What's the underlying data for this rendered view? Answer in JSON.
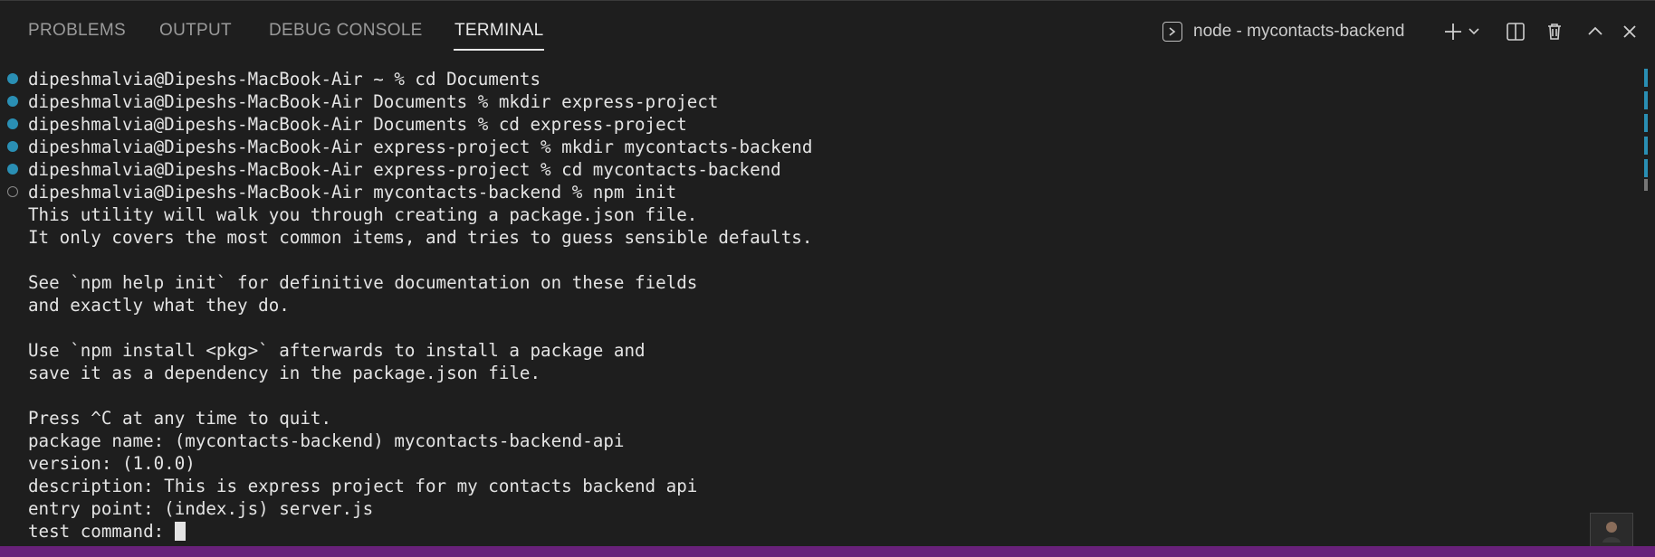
{
  "tabs": [
    {
      "label": "PROBLEMS"
    },
    {
      "label": "OUTPUT"
    },
    {
      "label": "DEBUG CONSOLE"
    },
    {
      "label": "TERMINAL"
    }
  ],
  "active_tab": "TERMINAL",
  "terminal_selector": {
    "label": "node - mycontacts-backend",
    "icon": "terminal-icon"
  },
  "header_icons": [
    "plus-icon",
    "chevron-down-icon",
    "split-icon",
    "trash-icon",
    "chevron-up-icon",
    "close-icon"
  ],
  "terminal_lines": [
    {
      "text": "dipeshmalvia@Dipeshs-MacBook-Air ~ % cd Documents",
      "decoration": "success"
    },
    {
      "text": "dipeshmalvia@Dipeshs-MacBook-Air Documents % mkdir express-project",
      "decoration": "success"
    },
    {
      "text": "dipeshmalvia@Dipeshs-MacBook-Air Documents % cd express-project",
      "decoration": "success"
    },
    {
      "text": "dipeshmalvia@Dipeshs-MacBook-Air express-project % mkdir mycontacts-backend",
      "decoration": "success"
    },
    {
      "text": "dipeshmalvia@Dipeshs-MacBook-Air express-project % cd mycontacts-backend",
      "decoration": "success"
    },
    {
      "text": "dipeshmalvia@Dipeshs-MacBook-Air mycontacts-backend % npm init",
      "decoration": "pending"
    },
    {
      "text": "This utility will walk you through creating a package.json file."
    },
    {
      "text": "It only covers the most common items, and tries to guess sensible defaults."
    },
    {
      "text": ""
    },
    {
      "text": "See `npm help init` for definitive documentation on these fields"
    },
    {
      "text": "and exactly what they do."
    },
    {
      "text": ""
    },
    {
      "text": "Use `npm install <pkg>` afterwards to install a package and"
    },
    {
      "text": "save it as a dependency in the package.json file."
    },
    {
      "text": ""
    },
    {
      "text": "Press ^C at any time to quit."
    },
    {
      "text": "package name: (mycontacts-backend) mycontacts-backend-api"
    },
    {
      "text": "version: (1.0.0)"
    },
    {
      "text": "description: This is express project for my contacts backend api"
    },
    {
      "text": "entry point: (index.js) server.js"
    },
    {
      "text": "test command: ",
      "cursor": true
    }
  ],
  "colors": {
    "background": "#1e1e1e",
    "text": "#e4e4e4",
    "decoration_success": "#2a8fb4",
    "tab_inactive": "#9a9a9a",
    "tab_active": "#e8e8e8",
    "status_strip": "#68217a"
  }
}
